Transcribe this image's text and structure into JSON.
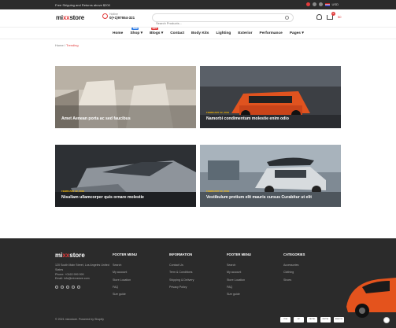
{
  "topbar": {
    "promo": "Free Shipping and Returns above $200",
    "currency": "USD"
  },
  "header": {
    "logo_a": "mi",
    "logo_b": "xx",
    "logo_c": "store",
    "hotline_label": "Hotline",
    "hotline_number": "0(+1)97654-321",
    "search_placeholder": "Search Products...",
    "cart_count": "0",
    "cart_total": "$0"
  },
  "nav": {
    "items": [
      {
        "label": "Home"
      },
      {
        "label": "Shop",
        "tag": "NEW"
      },
      {
        "label": "Blogs",
        "tag": "HOT"
      },
      {
        "label": "Contact"
      },
      {
        "label": "Body Kits"
      },
      {
        "label": "Lighting"
      },
      {
        "label": "Exterior"
      },
      {
        "label": "Performance"
      },
      {
        "label": "Pages"
      }
    ]
  },
  "breadcrumb": {
    "home": "Home",
    "sep": "/",
    "current": "Trending"
  },
  "posts": [
    {
      "date": "",
      "title": "Amet Aenean porta ac sed faucibus"
    },
    {
      "date": "FEBRUARY 22, 2019",
      "title": "Namorbi condimentum molestie enim odio"
    },
    {
      "date": "FEBRUARY 22, 2019",
      "title": "Nisullam ullamcorper quis ornare molestie"
    },
    {
      "date": "FEBRUARY 22, 2019",
      "title": "Vestibulum pretium elit mauris cursus Curabitur ut elit"
    }
  ],
  "footer": {
    "logo_a": "mi",
    "logo_b": "xx",
    "logo_c": "store",
    "address": "120 South Main Street, Los Angeles United States",
    "phone": "Phone: +0163 999 999",
    "email": "Email: info@mixxstore.com",
    "columns": [
      {
        "heading": "FOOTER MENU",
        "links": [
          "Search",
          "My account",
          "Store Location",
          "FAQ",
          "Size guide"
        ]
      },
      {
        "heading": "INFORMATION",
        "links": [
          "Contact Us",
          "Term & Conditions",
          "Shipping & Delivery",
          "Privacy Policy"
        ]
      },
      {
        "heading": "FOOTER MENU",
        "links": [
          "Search",
          "My account",
          "Store Location",
          "FAQ",
          "Size guide"
        ]
      },
      {
        "heading": "CATEGORIES",
        "links": [
          "Accessories",
          "Clothing",
          "Shoes"
        ]
      }
    ],
    "copyright": "© 2021 mixxstore. Powered by Shopify",
    "payments": [
      "VISA",
      "MC",
      "PAYPAL",
      "PAYPAL",
      "AMAZON"
    ]
  }
}
